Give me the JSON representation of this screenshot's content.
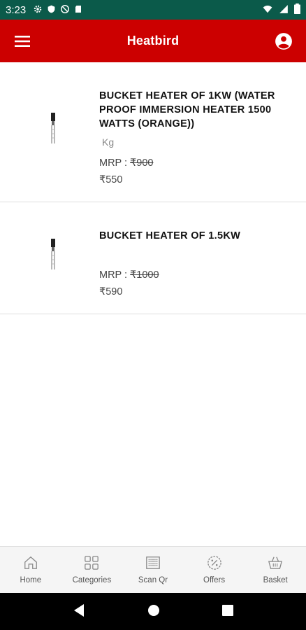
{
  "status_bar": {
    "time": "3:23",
    "icons_left": [
      "gear-icon",
      "shield-icon",
      "no-sync-icon",
      "sd-card-icon"
    ],
    "icons_right": [
      "wifi-icon",
      "signal-icon",
      "battery-icon"
    ]
  },
  "app_bar": {
    "title": "Heatbird",
    "menu_icon": "hamburger-menu-icon",
    "account_icon": "account-circle-icon"
  },
  "products": [
    {
      "name": "BUCKET HEATER OF  1KW (WATER PROOF IMMERSION HEATER 1500 WATTS (ORANGE))",
      "unit": "Kg",
      "mrp_label": "MRP : ",
      "mrp": "₹900",
      "price": "₹550"
    },
    {
      "name": "BUCKET HEATER OF  1.5KW",
      "unit": "",
      "mrp_label": "MRP : ",
      "mrp": "₹1000",
      "price": "₹590"
    }
  ],
  "bottom_nav": [
    {
      "label": "Home",
      "icon": "home-icon"
    },
    {
      "label": "Categories",
      "icon": "grid-icon"
    },
    {
      "label": "Scan Qr",
      "icon": "qr-scan-icon"
    },
    {
      "label": "Offers",
      "icon": "discount-badge-icon"
    },
    {
      "label": "Basket",
      "icon": "basket-icon"
    }
  ],
  "colors": {
    "status_bar": "#0b5a4a",
    "app_bar": "#cc0000",
    "nav_bg": "#f5f5f5"
  }
}
